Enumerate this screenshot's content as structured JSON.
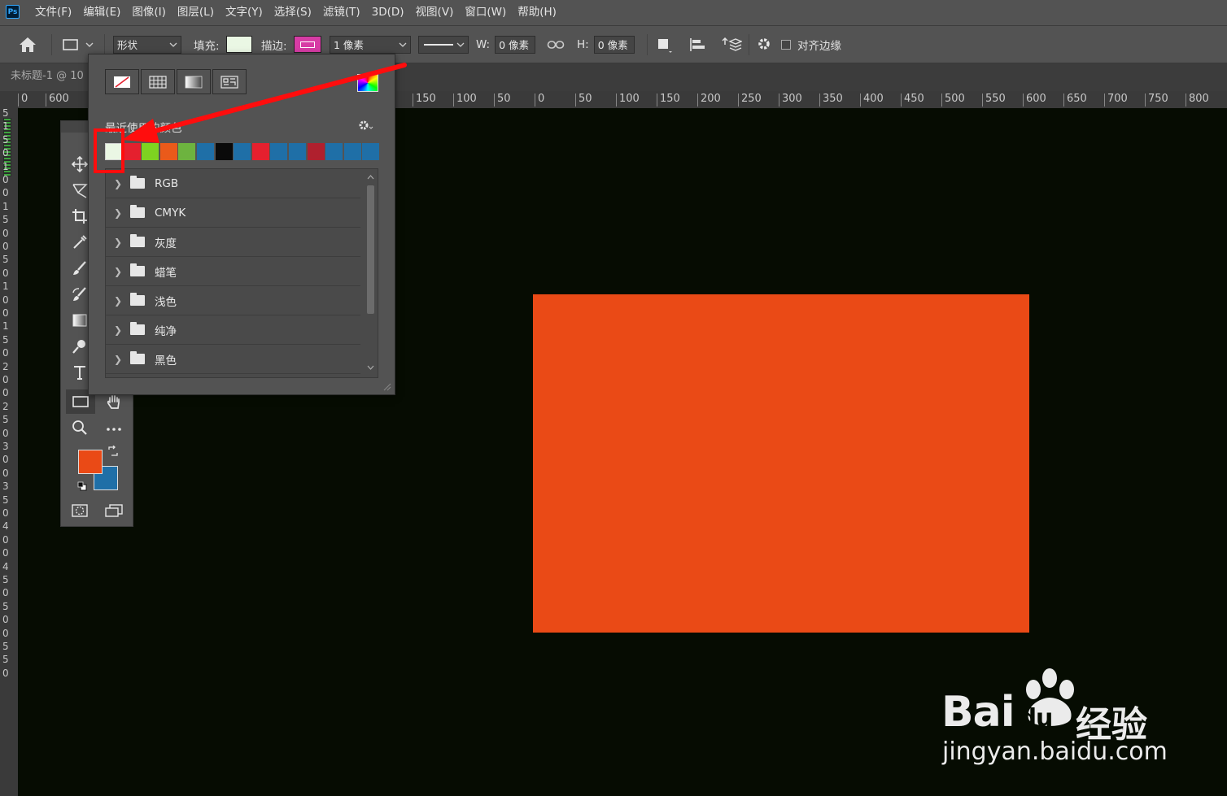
{
  "app": {
    "logo": "Ps"
  },
  "menu": [
    "文件(F)",
    "编辑(E)",
    "图像(I)",
    "图层(L)",
    "文字(Y)",
    "选择(S)",
    "滤镜(T)",
    "3D(D)",
    "视图(V)",
    "窗口(W)",
    "帮助(H)"
  ],
  "options": {
    "mode_value": "形状",
    "fill_label": "填充:",
    "stroke_label": "描边:",
    "stroke_width": "1 像素",
    "w_label": "W:",
    "w_value": "0 像素",
    "h_label": "H:",
    "h_value": "0 像素",
    "align_edges_label": "对齐边缘",
    "align_edges_checked": false
  },
  "document": {
    "tab_title": "未标题-1 @ 10"
  },
  "ruler": {
    "h_ticks": [
      "0",
      "600",
      "150",
      "100",
      "50",
      "0",
      "50",
      "100",
      "150",
      "200",
      "250",
      "300",
      "350",
      "400",
      "450",
      "500",
      "550",
      "600",
      "650",
      "700",
      "750",
      "800"
    ],
    "v_digits": [
      "5",
      "1",
      "5",
      "0",
      "1",
      "0",
      "0",
      "1",
      "5",
      "0",
      "0",
      "5",
      "0",
      "1",
      "0",
      "0",
      "1",
      "5",
      "0",
      "2",
      "0",
      "0",
      "2",
      "5",
      "0",
      "3",
      "0",
      "0",
      "3",
      "5",
      "0",
      "4",
      "0",
      "0",
      "4",
      "5",
      "0",
      "5",
      "0",
      "0",
      "5",
      "5",
      "0"
    ]
  },
  "swatch_panel": {
    "recent_label": "最近使用的颜色",
    "recent_colors": [
      "#eaf7e4",
      "#e5202e",
      "#7ed321",
      "#ea5a1a",
      "#6db33f",
      "#1f6fa7",
      "#0a0a0a",
      "#1f6fa7",
      "#e5202e",
      "#1f6fa7",
      "#1f6fa7",
      "#b0202e",
      "#1f6fa7",
      "#1f6fa7",
      "#1f6fa7"
    ],
    "groups": [
      "RGB",
      "CMYK",
      "灰度",
      "蜡笔",
      "浅色",
      "纯净",
      "黑色"
    ]
  },
  "colors": {
    "foreground": "#ea4a16",
    "background": "#1f6fa7",
    "fill": "#eaf7e4",
    "stroke": "#d73ca5",
    "canvas": "#060c02",
    "shape": "#ea4a16",
    "annotation": "#ff0d0d"
  },
  "watermark": {
    "brand": "Bai",
    "brand2": "du",
    "cn": "经验",
    "url": "jingyan.baidu.com"
  }
}
